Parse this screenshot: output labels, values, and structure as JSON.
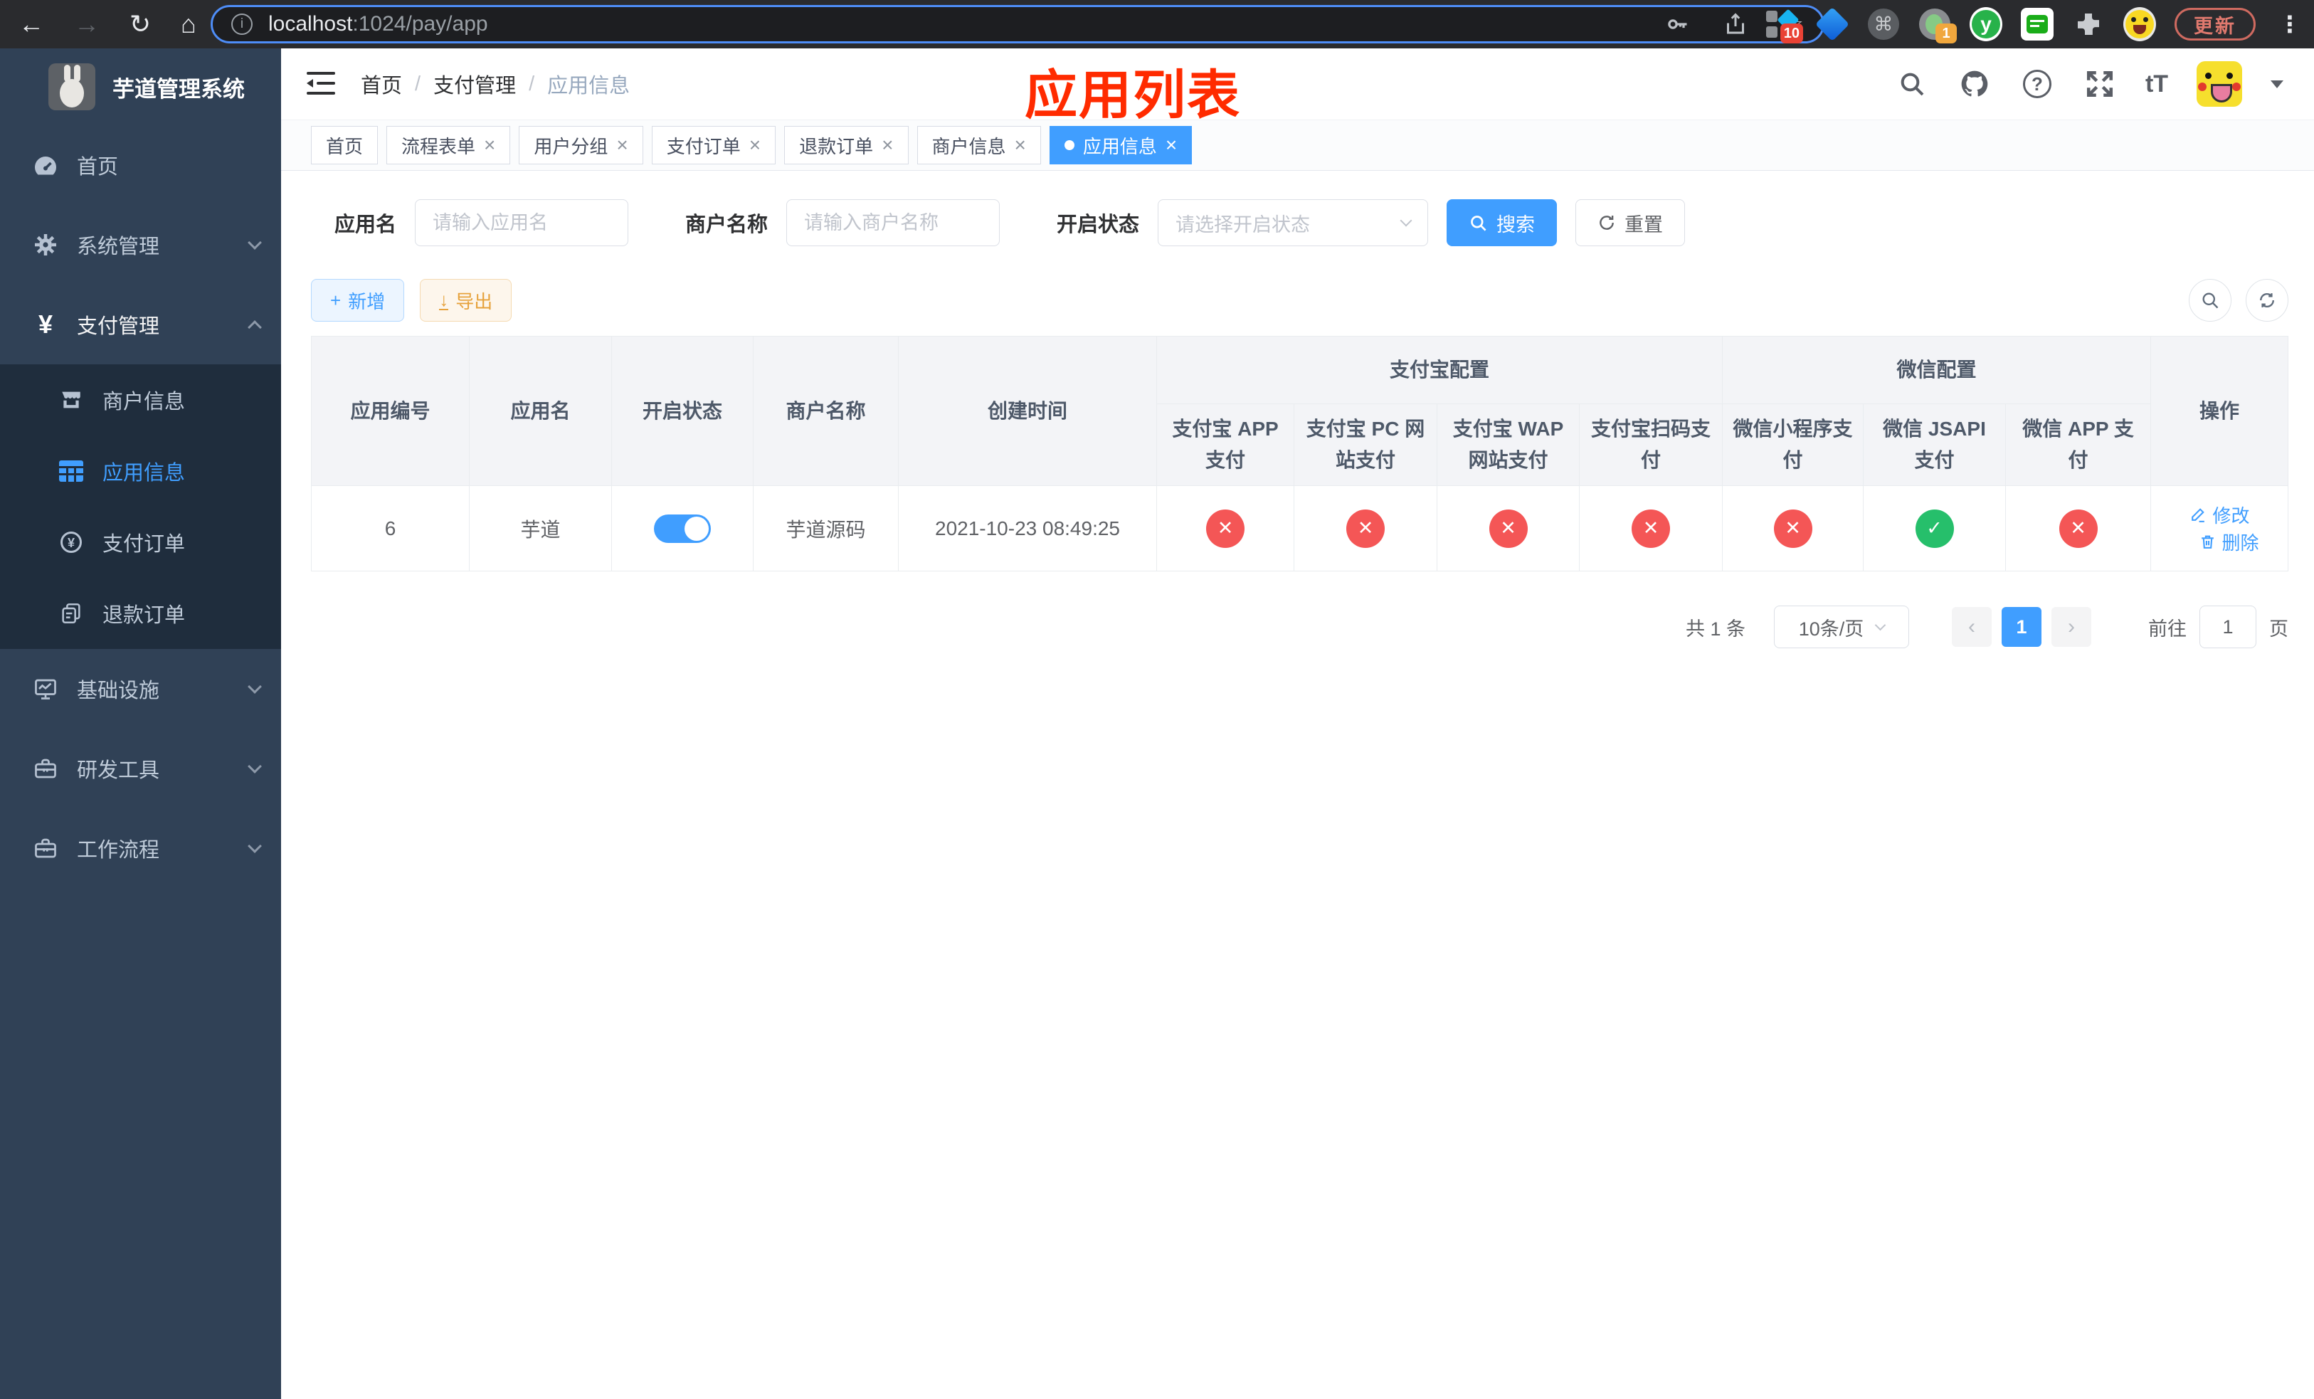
{
  "browser": {
    "url_host": "localhost",
    "url_rest": ":1024/pay/app",
    "ext_badge_10": "10",
    "ext_badge_1": "1",
    "update_label": "更新"
  },
  "sidebar": {
    "title": "芋道管理系统",
    "menu": [
      {
        "label": "首页"
      },
      {
        "label": "系统管理"
      },
      {
        "label": "支付管理"
      },
      {
        "label": "基础设施"
      },
      {
        "label": "研发工具"
      },
      {
        "label": "工作流程"
      }
    ],
    "submenu": [
      {
        "label": "商户信息"
      },
      {
        "label": "应用信息"
      },
      {
        "label": "支付订单"
      },
      {
        "label": "退款订单"
      }
    ]
  },
  "navbar": {
    "breadcrumb": [
      {
        "label": "首页"
      },
      {
        "label": "支付管理"
      },
      {
        "label": "应用信息"
      }
    ],
    "annotation": "应用列表"
  },
  "tabs": [
    {
      "label": "首页"
    },
    {
      "label": "流程表单"
    },
    {
      "label": "用户分组"
    },
    {
      "label": "支付订单"
    },
    {
      "label": "退款订单"
    },
    {
      "label": "商户信息"
    },
    {
      "label": "应用信息"
    }
  ],
  "filters": {
    "app_name_label": "应用名",
    "app_name_placeholder": "请输入应用名",
    "merchant_label": "商户名称",
    "merchant_placeholder": "请输入商户名称",
    "status_label": "开启状态",
    "status_placeholder": "请选择开启状态",
    "search_label": "搜索",
    "reset_label": "重置"
  },
  "toolbar": {
    "add_label": "新增",
    "export_label": "导出"
  },
  "table": {
    "headers": {
      "app_id": "应用编号",
      "app_name": "应用名",
      "status": "开启状态",
      "merchant": "商户名称",
      "created": "创建时间",
      "alipay_group": "支付宝配置",
      "wechat_group": "微信配置",
      "alipay_app": "支付宝 APP 支付",
      "alipay_pc": "支付宝 PC 网站支付",
      "alipay_wap": "支付宝 WAP 网站支付",
      "alipay_qr": "支付宝扫码支付",
      "wx_mini": "微信小程序支付",
      "wx_jsapi": "微信 JSAPI 支付",
      "wx_app": "微信 APP 支付",
      "actions": "操作"
    },
    "row": {
      "app_id": "6",
      "app_name": "芋道",
      "status_on": true,
      "merchant": "芋道源码",
      "created": "2021-10-23 08:49:25",
      "pay_configs": [
        false,
        false,
        false,
        false,
        false,
        true,
        false
      ],
      "edit_label": "修改",
      "delete_label": "删除"
    }
  },
  "pagination": {
    "total": "共 1 条",
    "page_size": "10条/页",
    "page": "1",
    "prev": "‹",
    "next": "›",
    "goto_label": "前往",
    "goto_value": "1",
    "page_unit": "页"
  },
  "colors": {
    "accent": "#409eff",
    "sidebar_bg": "#304156",
    "submenu_bg": "#1f2d3d",
    "danger": "#f45656",
    "success": "#26bf6b",
    "annotation": "#ff2b00"
  },
  "icons": {
    "back": "←",
    "forward": "→",
    "reload": "↻",
    "home": "⌂",
    "info": "i",
    "star": "☆",
    "cmd": "⌘",
    "ext_y": "y",
    "menu_dots": "⋮",
    "question": "?",
    "text_size": "tT",
    "sep": "/",
    "close": "×",
    "plus": "+",
    "download": "↓",
    "check": "✓",
    "cross": "✕",
    "yen": "¥"
  }
}
